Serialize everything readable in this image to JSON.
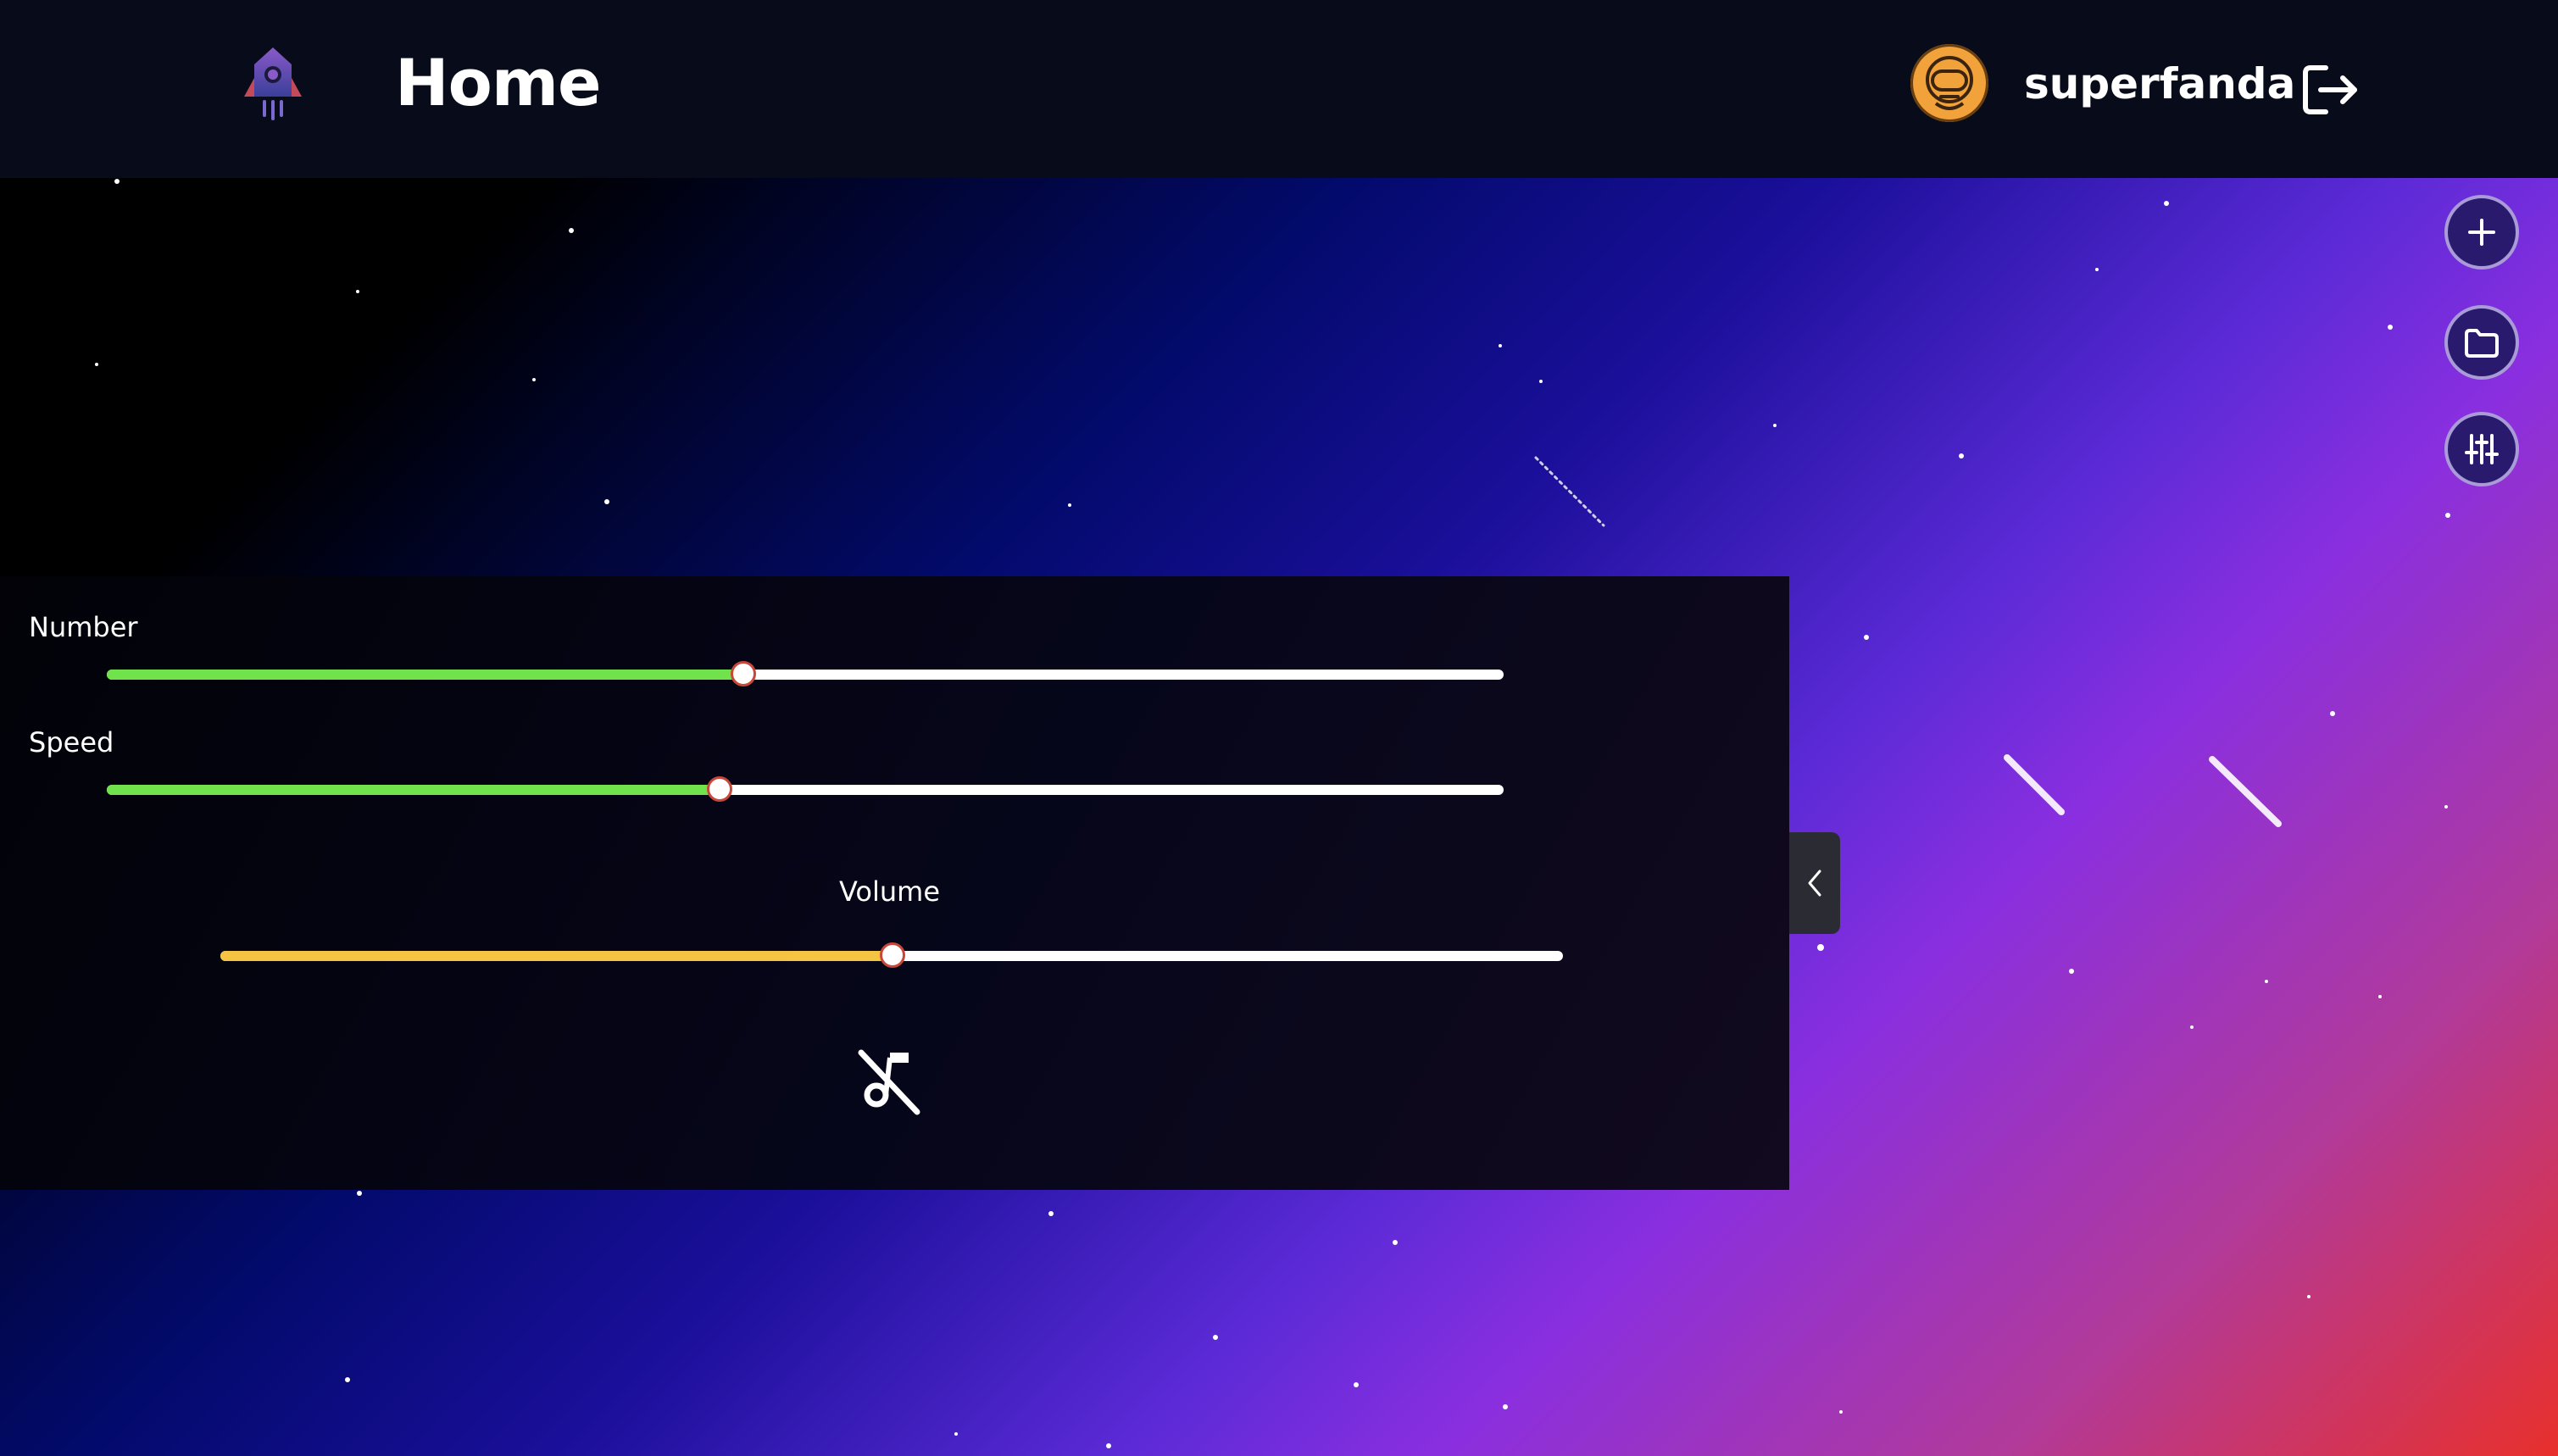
{
  "header": {
    "title": "Home",
    "username": "superfanda",
    "logo_icon": "rocket-icon",
    "avatar_icon": "astronaut-avatar",
    "logout_icon": "logout-icon"
  },
  "fabs": [
    {
      "icon": "plus-icon"
    },
    {
      "icon": "folder-icon"
    },
    {
      "icon": "sliders-icon"
    }
  ],
  "settings_panel": {
    "number": {
      "label": "Number",
      "value_fraction": 0.455
    },
    "speed": {
      "label": "Speed",
      "value_fraction": 0.438
    },
    "volume": {
      "label": "Volume",
      "value_fraction": 0.5
    },
    "mute_icon": "music-off-icon",
    "collapse_icon": "chevron-left-icon"
  },
  "colors": {
    "slider_fill_green": "#6fe24c",
    "slider_fill_yellow": "#f5c442",
    "fab_background": "#2a1a6e",
    "avatar_orange": "#f2a23a"
  }
}
